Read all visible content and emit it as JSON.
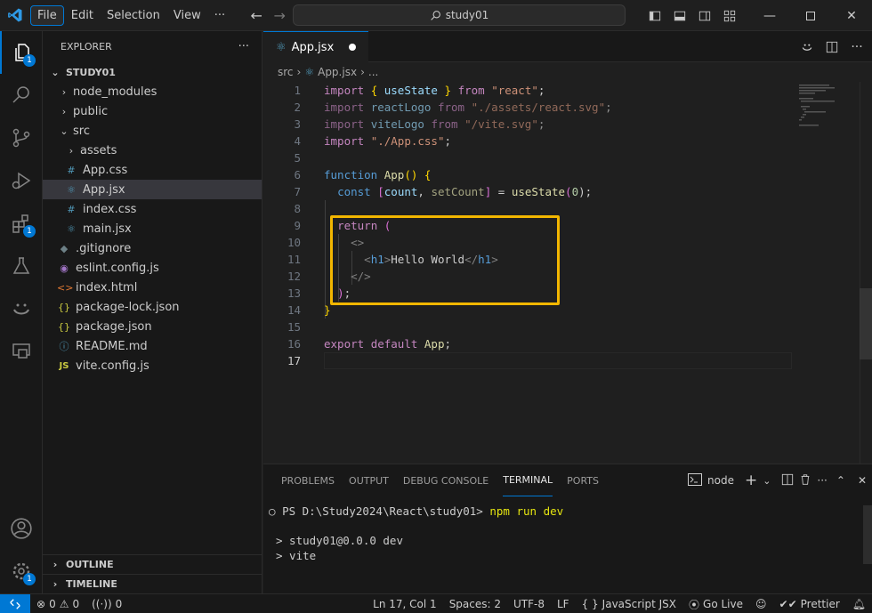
{
  "menu": {
    "file": "File",
    "edit": "Edit",
    "selection": "Selection",
    "view": "View",
    "more": "···"
  },
  "search": {
    "text": "study01"
  },
  "activity_badges": {
    "explorer": "1",
    "extensions": "1",
    "manage": "1"
  },
  "explorer": {
    "title": "EXPLORER",
    "more": "···",
    "folder": "STUDY01",
    "items": [
      {
        "label": "node_modules",
        "kind": "folder"
      },
      {
        "label": "public",
        "kind": "folder"
      },
      {
        "label": "src",
        "kind": "folder-open"
      },
      {
        "label": "assets",
        "kind": "folder"
      },
      {
        "label": "App.css",
        "kind": "css"
      },
      {
        "label": "App.jsx",
        "kind": "react"
      },
      {
        "label": "index.css",
        "kind": "css"
      },
      {
        "label": "main.jsx",
        "kind": "react"
      },
      {
        "label": ".gitignore",
        "kind": "git"
      },
      {
        "label": "eslint.config.js",
        "kind": "eslint"
      },
      {
        "label": "index.html",
        "kind": "html"
      },
      {
        "label": "package-lock.json",
        "kind": "json"
      },
      {
        "label": "package.json",
        "kind": "json"
      },
      {
        "label": "README.md",
        "kind": "info"
      },
      {
        "label": "vite.config.js",
        "kind": "js"
      }
    ],
    "outline": "OUTLINE",
    "timeline": "TIMELINE"
  },
  "editor": {
    "tab": "App.jsx",
    "breadcrumb": {
      "folder": "src",
      "file": "App.jsx",
      "more": "..."
    },
    "line_numbers": [
      "1",
      "2",
      "3",
      "4",
      "5",
      "6",
      "7",
      "8",
      "9",
      "10",
      "11",
      "12",
      "13",
      "14",
      "15",
      "16",
      "17"
    ],
    "code": {
      "l1": {
        "a": "import",
        "b": "{",
        "c": "useState",
        "d": "}",
        "e": "from",
        "f": "\"react\"",
        "g": ";"
      },
      "l2": {
        "a": "import",
        "b": "reactLogo",
        "c": "from",
        "d": "\"./assets/react.svg\"",
        "e": ";"
      },
      "l3": {
        "a": "import",
        "b": "viteLogo",
        "c": "from",
        "d": "\"/vite.svg\"",
        "e": ";"
      },
      "l4": {
        "a": "import",
        "b": "\"./App.css\"",
        "c": ";"
      },
      "l6": {
        "a": "function",
        "b": "App",
        "c": "()",
        "d": "{"
      },
      "l7": {
        "a": "const",
        "b": "[",
        "c": "count",
        "d": ",",
        "e": "setCount",
        "f": "]",
        "g": "=",
        "h": "useState",
        "i": "(",
        "j": "0",
        "k": ");"
      },
      "l9": {
        "a": "return",
        "b": "("
      },
      "l10": {
        "a": "<>"
      },
      "l11": {
        "a": "<",
        "b": "h1",
        "c": ">",
        "d": "Hello World",
        "e": "</",
        "f": "h1",
        "g": ">"
      },
      "l12": {
        "a": "</>"
      },
      "l13": {
        "a": ")",
        "b": ";"
      },
      "l14": {
        "a": "}"
      },
      "l16": {
        "a": "export",
        "b": "default",
        "c": "App",
        "d": ";"
      }
    }
  },
  "panel": {
    "tabs": [
      "PROBLEMS",
      "OUTPUT",
      "DEBUG CONSOLE",
      "TERMINAL",
      "PORTS"
    ],
    "terminal_name": "node",
    "prompt": "PS D:\\Study2024\\React\\study01>",
    "command": "npm run dev",
    "out1": "> study01@0.0.0 dev",
    "out2": "> vite"
  },
  "status": {
    "errors": "0",
    "warnings": "0",
    "ports": "0",
    "position": "Ln 17, Col 1",
    "spaces": "Spaces: 2",
    "encoding": "UTF-8",
    "eol": "LF",
    "language": "JavaScript JSX",
    "golive": "Go Live",
    "prettier": "Prettier"
  },
  "colors": {
    "accent": "#0078d4",
    "highlight": "#f2b600"
  }
}
